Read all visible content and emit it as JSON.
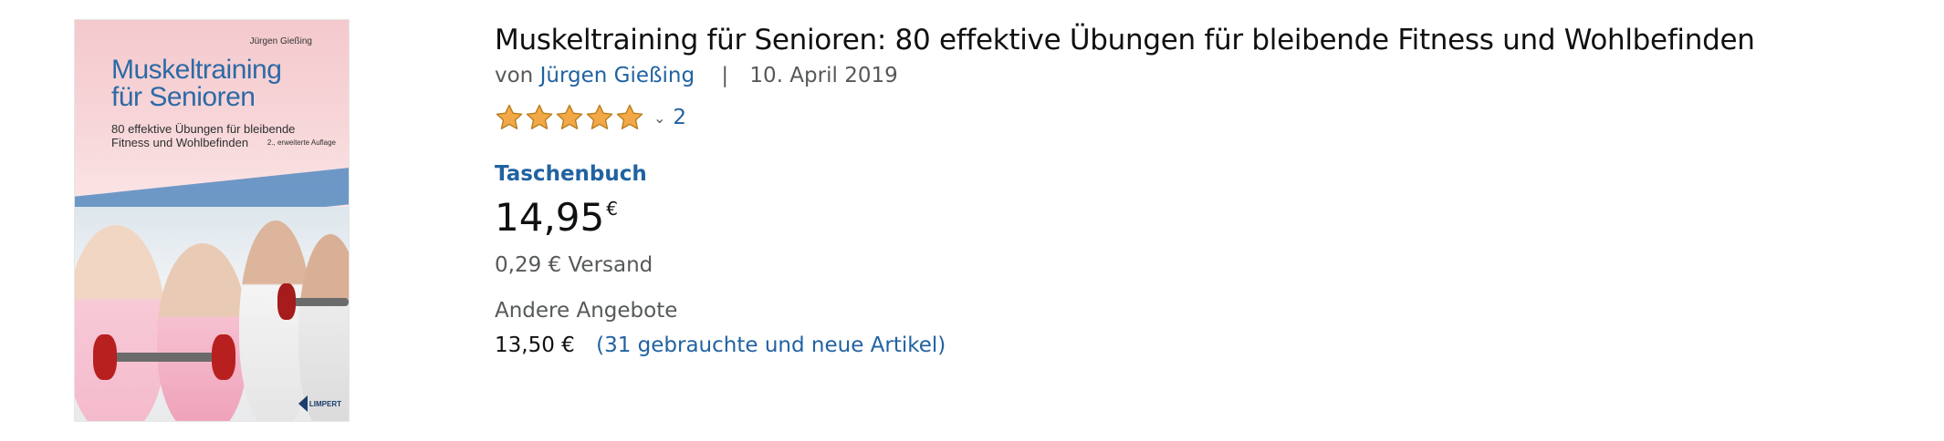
{
  "colors": {
    "link": "#2162a1",
    "text": "#0f1111",
    "secondary_text": "#565959",
    "star": "#f3a847"
  },
  "cover": {
    "author": "Jürgen Gießing",
    "title_line1": "Muskeltraining",
    "title_line2": "für Senioren",
    "subtitle": "80 effektive Übungen für bleibende Fitness und Wohlbefinden",
    "edition": "2., erweiterte Auflage",
    "publisher": "LIMPERT"
  },
  "product": {
    "title": "Muskeltraining für Senioren: 80 effektive Übungen für bleibende Fitness und Wohlbefinden",
    "by_prefix": "von",
    "author": "Jürgen Gießing",
    "separator": "|",
    "date": "10. April 2019",
    "rating": {
      "stars": 5,
      "max_stars": 5,
      "chevron_icon": "chevron-down-icon",
      "count": "2"
    },
    "format": "Taschenbuch",
    "price_whole": "14,95",
    "price_currency": "€",
    "shipping": "0,29 € Versand",
    "other_offers_label": "Andere Angebote",
    "other_offers_price": "13,50 €",
    "other_offers_link": "(31 gebrauchte und neue Artikel)"
  }
}
